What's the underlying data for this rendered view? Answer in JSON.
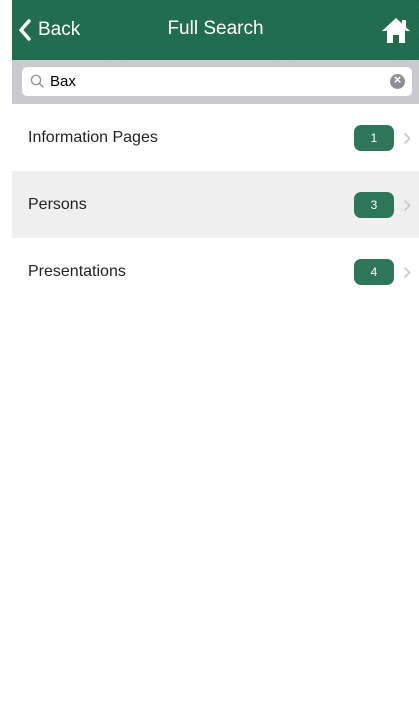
{
  "navbar": {
    "back_label": "Back",
    "title": "Full Search",
    "back_icon": "chevron-left-icon",
    "home_icon": "home-icon"
  },
  "search": {
    "value": "Bax",
    "icon": "search-icon",
    "clear_icon": "clear-icon"
  },
  "results": [
    {
      "label": "Information Pages",
      "count": "1"
    },
    {
      "label": "Persons",
      "count": "3"
    },
    {
      "label": "Presentations",
      "count": "4"
    }
  ],
  "colors": {
    "navbar": "#1f6b4d",
    "badge": "#2e7659",
    "search_bar": "#c9c9ce",
    "row_shaded": "#efefef"
  }
}
